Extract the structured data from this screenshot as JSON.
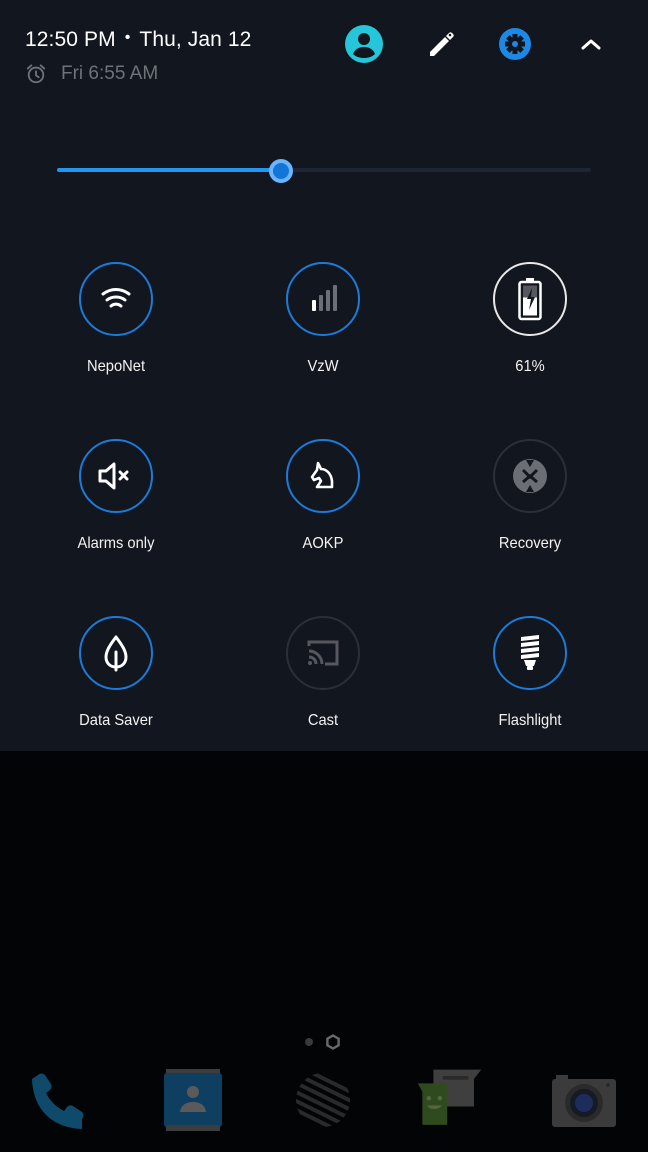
{
  "header": {
    "time": "12:50 PM",
    "separator": "•",
    "date": "Thu, Jan 12",
    "alarm_icon": "alarm-clock-icon",
    "next_alarm": "Fri 6:55 AM",
    "actions": [
      {
        "name": "user-switcher",
        "icon": "account-circle-icon"
      },
      {
        "name": "edit-tiles",
        "icon": "pencil-icon"
      },
      {
        "name": "settings",
        "icon": "gear-icon"
      },
      {
        "name": "collapse",
        "icon": "chevron-up-icon"
      }
    ]
  },
  "brightness": {
    "level_percent": 42
  },
  "tiles": [
    {
      "label": "NepoNet",
      "icon": "wifi-icon",
      "state": "on"
    },
    {
      "label": "VzW",
      "icon": "cellular-signal-icon",
      "state": "on"
    },
    {
      "label": "61%",
      "icon": "battery-charging-icon",
      "state": "neutral",
      "battery_percent": 61
    },
    {
      "label": "Alarms only",
      "icon": "volume-off-icon",
      "state": "on"
    },
    {
      "label": "AOKP",
      "icon": "unicorn-icon",
      "state": "on"
    },
    {
      "label": "Recovery",
      "icon": "twrp-recovery-icon",
      "state": "off"
    },
    {
      "label": "Data Saver",
      "icon": "leaf-icon",
      "state": "on"
    },
    {
      "label": "Cast",
      "icon": "cast-icon",
      "state": "off"
    },
    {
      "label": "Flashlight",
      "icon": "bulb-icon",
      "state": "on"
    }
  ],
  "colors": {
    "accent": "#1e7ad6",
    "panel_bg": "#12161f",
    "user_icon": "#26c6da",
    "settings_icon": "#1e88e5"
  },
  "home": {
    "pages": 2,
    "current_page": 1,
    "dock": [
      {
        "name": "phone",
        "icon": "phone-icon"
      },
      {
        "name": "contacts",
        "icon": "contacts-icon"
      },
      {
        "name": "app-drawer",
        "icon": "app-drawer-icon"
      },
      {
        "name": "messaging",
        "icon": "messaging-icon"
      },
      {
        "name": "camera",
        "icon": "camera-icon"
      }
    ]
  }
}
